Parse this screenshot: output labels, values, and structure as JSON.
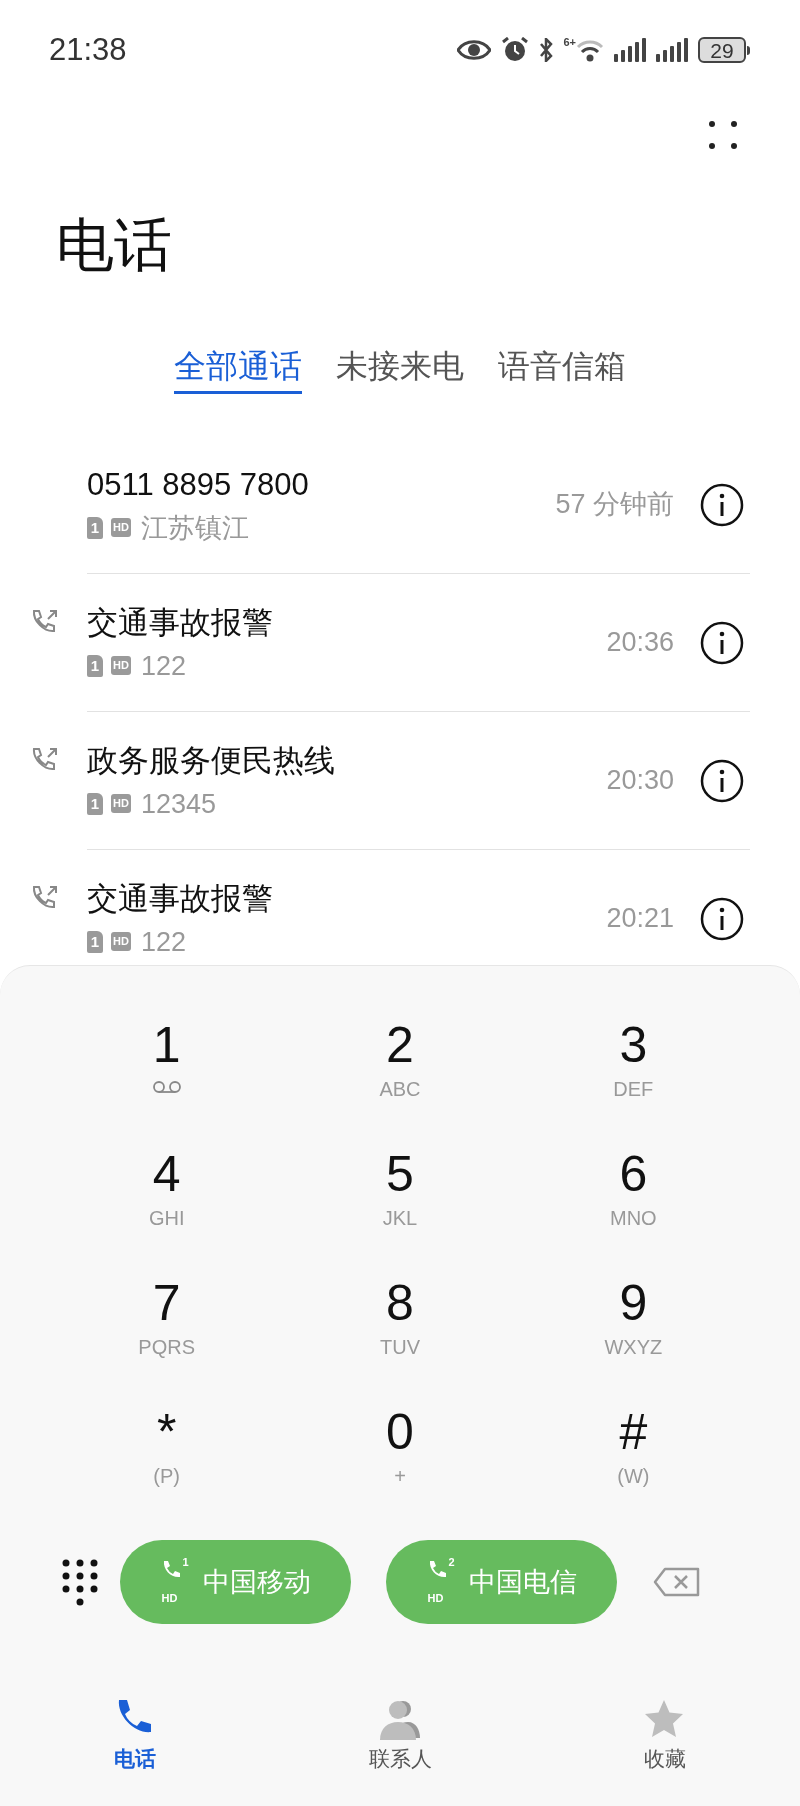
{
  "status_bar": {
    "time": "21:38",
    "wifi_label": "6+",
    "battery": "29"
  },
  "title": "电话",
  "tabs": [
    {
      "label": "全部通话",
      "selected": true
    },
    {
      "label": "未接来电",
      "selected": false
    },
    {
      "label": "语音信箱",
      "selected": false
    }
  ],
  "calls": [
    {
      "kind": "plain",
      "name": "0511 8895 7800",
      "sim": "1",
      "hd": "HD",
      "detail": "江苏镇江",
      "time": "57 分钟前"
    },
    {
      "kind": "outgoing",
      "name": "交通事故报警",
      "sim": "1",
      "hd": "HD",
      "detail": "122",
      "time": "20:36"
    },
    {
      "kind": "outgoing",
      "name": "政务服务便民热线",
      "sim": "1",
      "hd": "HD",
      "detail": "12345",
      "time": "20:30"
    },
    {
      "kind": "outgoing",
      "name": "交通事故报警",
      "sim": "1",
      "hd": "HD",
      "detail": "122",
      "time": "20:21"
    }
  ],
  "keypad": [
    {
      "kind": "voicemail",
      "digit": "1"
    },
    {
      "kind": "letters",
      "digit": "2",
      "sub": "ABC"
    },
    {
      "kind": "letters",
      "digit": "3",
      "sub": "DEF"
    },
    {
      "kind": "letters",
      "digit": "4",
      "sub": "GHI"
    },
    {
      "kind": "letters",
      "digit": "5",
      "sub": "JKL"
    },
    {
      "kind": "letters",
      "digit": "6",
      "sub": "MNO"
    },
    {
      "kind": "letters",
      "digit": "7",
      "sub": "PQRS"
    },
    {
      "kind": "letters",
      "digit": "8",
      "sub": "TUV"
    },
    {
      "kind": "letters",
      "digit": "9",
      "sub": "WXYZ"
    },
    {
      "kind": "letters",
      "digit": "*",
      "sub": "(P)"
    },
    {
      "kind": "letters",
      "digit": "0",
      "sub": "+"
    },
    {
      "kind": "letters",
      "digit": "#",
      "sub": "(W)"
    }
  ],
  "call_buttons": [
    {
      "sim": "1",
      "hd": "HD",
      "label": "中国移动"
    },
    {
      "sim": "2",
      "hd": "HD",
      "label": "中国电信"
    }
  ],
  "bottom_nav": [
    {
      "kind": "phone",
      "label": "电话",
      "selected": true
    },
    {
      "kind": "contacts",
      "label": "联系人",
      "selected": false
    },
    {
      "kind": "star",
      "label": "收藏",
      "selected": false
    }
  ]
}
